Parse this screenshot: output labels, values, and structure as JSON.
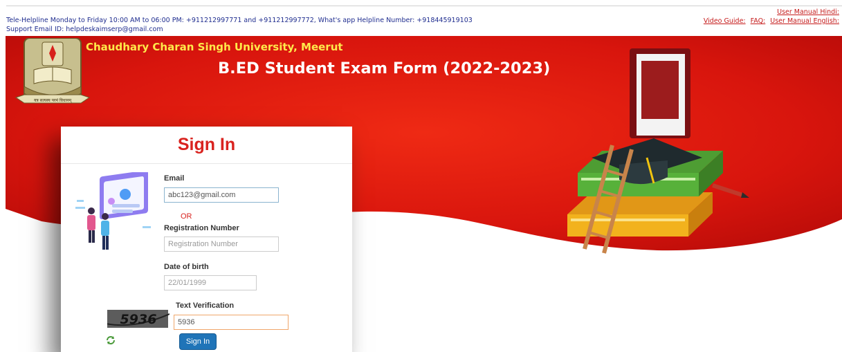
{
  "header": {
    "helpline": "Tele-Helpline Monday to Friday 10:00 AM to 06:00 PM: +911212997771 and +911212997772, What's app Helpline Number: +918445919103",
    "support_email": "Support Email ID: helpdeskaimserp@gmail.com",
    "links": {
      "manual_hindi": "User Manual Hindi:",
      "video_guide": "Video Guide:",
      "faq": "FAQ:",
      "manual_english": "User Manual English:"
    }
  },
  "banner": {
    "university": "Chaudhary Charan Singh University, Meerut",
    "form_title": "B.ED Student Exam Form (2022-2023)",
    "logo_motto": "यत्र सत्यस्य परमं विधानम्"
  },
  "signin": {
    "title": "Sign In",
    "email_label": "Email",
    "email_value": "abc123@gmail.com",
    "or_text": "OR",
    "reg_label": "Registration Number",
    "reg_placeholder": "Registration Number",
    "dob_label": "Date of birth",
    "dob_placeholder": "22/01/1999",
    "captcha_label": "Text Verification",
    "captcha_image_text": "5936",
    "captcha_value": "5936",
    "button_label": "Sign In"
  },
  "colors": {
    "banner_red": "#d8150d",
    "title_red": "#d9231f",
    "link_red": "#c51a1a",
    "helpline_blue": "#1f2d8f",
    "university_yellow": "#ffe94a",
    "button_blue": "#1f74b8"
  },
  "icons": {
    "logo": "university-seal-icon",
    "illustration": "login-illustration",
    "books": "books-graduation-cap-illustration",
    "refresh": "refresh-icon"
  }
}
